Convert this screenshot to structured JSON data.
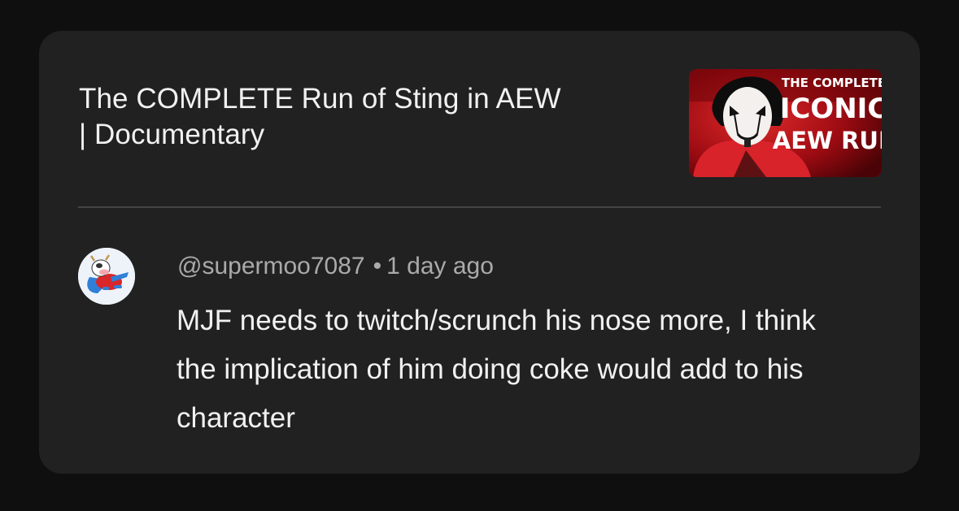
{
  "video": {
    "title_line1": "The COMPLETE Run of Sting in AEW",
    "title_line2": "| Documentary",
    "thumbnail": {
      "line1": "THE COMPLETE",
      "line2": "ICONIC",
      "line3": "AEW RUN",
      "accent_color": "#c4141c"
    }
  },
  "comment": {
    "author": "@supermoo7087",
    "separator": "•",
    "timestamp": "1 day ago",
    "text": "MJF needs to twitch/scrunch his nose more, I think the implication of him doing coke would add to his character",
    "avatar_icon": "cartoon-cow-superhero-avatar"
  },
  "theme": {
    "background": "#0f0f0f",
    "card": "#212121",
    "text_primary": "#f1f1f1",
    "text_secondary": "#aaaaaa"
  }
}
